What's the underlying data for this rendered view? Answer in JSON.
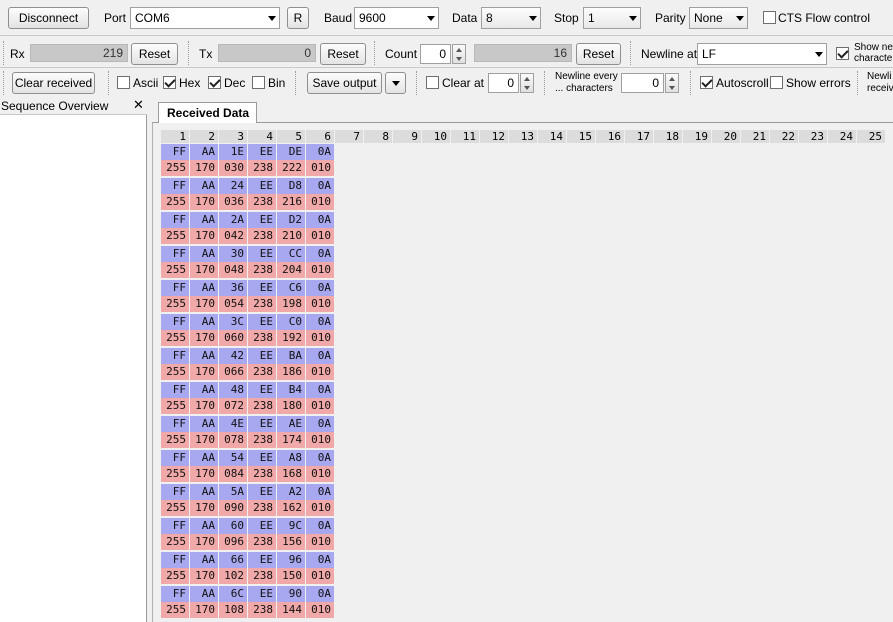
{
  "toolbar1": {
    "disconnect": "Disconnect",
    "port_label": "Port",
    "port_value": "COM6",
    "r_button": "R",
    "baud_label": "Baud",
    "baud_value": "9600",
    "data_label": "Data",
    "data_value": "8",
    "stop_label": "Stop",
    "stop_value": "1",
    "parity_label": "Parity",
    "parity_value": "None",
    "cts_label": "CTS Flow control",
    "cts_checked": false
  },
  "toolbar2": {
    "rx_label": "Rx",
    "rx_value": "219",
    "rx_reset": "Reset",
    "tx_label": "Tx",
    "tx_value": "0",
    "tx_reset": "Reset",
    "count_label": "Count",
    "count_value": "0",
    "count_bar_value": "16",
    "count_reset": "Reset",
    "newline_at_label": "Newline at",
    "newline_at_value": "LF",
    "show_newline_label_1": "Show ne",
    "show_newline_label_2": "characte",
    "show_newline_checked": true
  },
  "toolbar3": {
    "clear_received": "Clear received",
    "ascii_label": "Ascii",
    "ascii_checked": false,
    "hex_label": "Hex",
    "hex_checked": true,
    "dec_label": "Dec",
    "dec_checked": true,
    "bin_label": "Bin",
    "bin_checked": false,
    "save_output": "Save output",
    "clear_at_label": "Clear at",
    "clear_at_checked": false,
    "clear_at_value": "0",
    "newline_every_label_1": "Newline every",
    "newline_every_label_2": "... characters",
    "newline_every_value": "0",
    "autoscroll_label": "Autoscroll",
    "autoscroll_checked": true,
    "show_errors_label": "Show errors",
    "show_errors_checked": false,
    "newline_receive_label_1": "Newli",
    "newline_receive_label_2": "receiv"
  },
  "left_panel": {
    "title": "Sequence Overview",
    "close": "✕"
  },
  "tab": {
    "label": "Received Data"
  },
  "grid": {
    "columns": [
      "1",
      "2",
      "3",
      "4",
      "5",
      "6",
      "7",
      "8",
      "9",
      "10",
      "11",
      "12",
      "13",
      "14",
      "15",
      "16",
      "17",
      "18",
      "19",
      "20",
      "21",
      "22",
      "23",
      "24",
      "25"
    ],
    "rows": [
      {
        "hex": [
          "FF",
          "AA",
          "1E",
          "EE",
          "DE",
          "0A"
        ],
        "dec": [
          "255",
          "170",
          "030",
          "238",
          "222",
          "010"
        ]
      },
      {
        "hex": [
          "FF",
          "AA",
          "24",
          "EE",
          "D8",
          "0A"
        ],
        "dec": [
          "255",
          "170",
          "036",
          "238",
          "216",
          "010"
        ]
      },
      {
        "hex": [
          "FF",
          "AA",
          "2A",
          "EE",
          "D2",
          "0A"
        ],
        "dec": [
          "255",
          "170",
          "042",
          "238",
          "210",
          "010"
        ]
      },
      {
        "hex": [
          "FF",
          "AA",
          "30",
          "EE",
          "CC",
          "0A"
        ],
        "dec": [
          "255",
          "170",
          "048",
          "238",
          "204",
          "010"
        ]
      },
      {
        "hex": [
          "FF",
          "AA",
          "36",
          "EE",
          "C6",
          "0A"
        ],
        "dec": [
          "255",
          "170",
          "054",
          "238",
          "198",
          "010"
        ]
      },
      {
        "hex": [
          "FF",
          "AA",
          "3C",
          "EE",
          "C0",
          "0A"
        ],
        "dec": [
          "255",
          "170",
          "060",
          "238",
          "192",
          "010"
        ]
      },
      {
        "hex": [
          "FF",
          "AA",
          "42",
          "EE",
          "BA",
          "0A"
        ],
        "dec": [
          "255",
          "170",
          "066",
          "238",
          "186",
          "010"
        ]
      },
      {
        "hex": [
          "FF",
          "AA",
          "48",
          "EE",
          "B4",
          "0A"
        ],
        "dec": [
          "255",
          "170",
          "072",
          "238",
          "180",
          "010"
        ]
      },
      {
        "hex": [
          "FF",
          "AA",
          "4E",
          "EE",
          "AE",
          "0A"
        ],
        "dec": [
          "255",
          "170",
          "078",
          "238",
          "174",
          "010"
        ]
      },
      {
        "hex": [
          "FF",
          "AA",
          "54",
          "EE",
          "A8",
          "0A"
        ],
        "dec": [
          "255",
          "170",
          "084",
          "238",
          "168",
          "010"
        ]
      },
      {
        "hex": [
          "FF",
          "AA",
          "5A",
          "EE",
          "A2",
          "0A"
        ],
        "dec": [
          "255",
          "170",
          "090",
          "238",
          "162",
          "010"
        ]
      },
      {
        "hex": [
          "FF",
          "AA",
          "60",
          "EE",
          "9C",
          "0A"
        ],
        "dec": [
          "255",
          "170",
          "096",
          "238",
          "156",
          "010"
        ]
      },
      {
        "hex": [
          "FF",
          "AA",
          "66",
          "EE",
          "96",
          "0A"
        ],
        "dec": [
          "255",
          "170",
          "102",
          "238",
          "150",
          "010"
        ]
      },
      {
        "hex": [
          "FF",
          "AA",
          "6C",
          "EE",
          "90",
          "0A"
        ],
        "dec": [
          "255",
          "170",
          "108",
          "238",
          "144",
          "010"
        ]
      }
    ]
  },
  "colors": {
    "hex_cell": "#a8a8f0",
    "dec_cell": "#f0a8a8",
    "column_header": "#dcdcdc"
  }
}
